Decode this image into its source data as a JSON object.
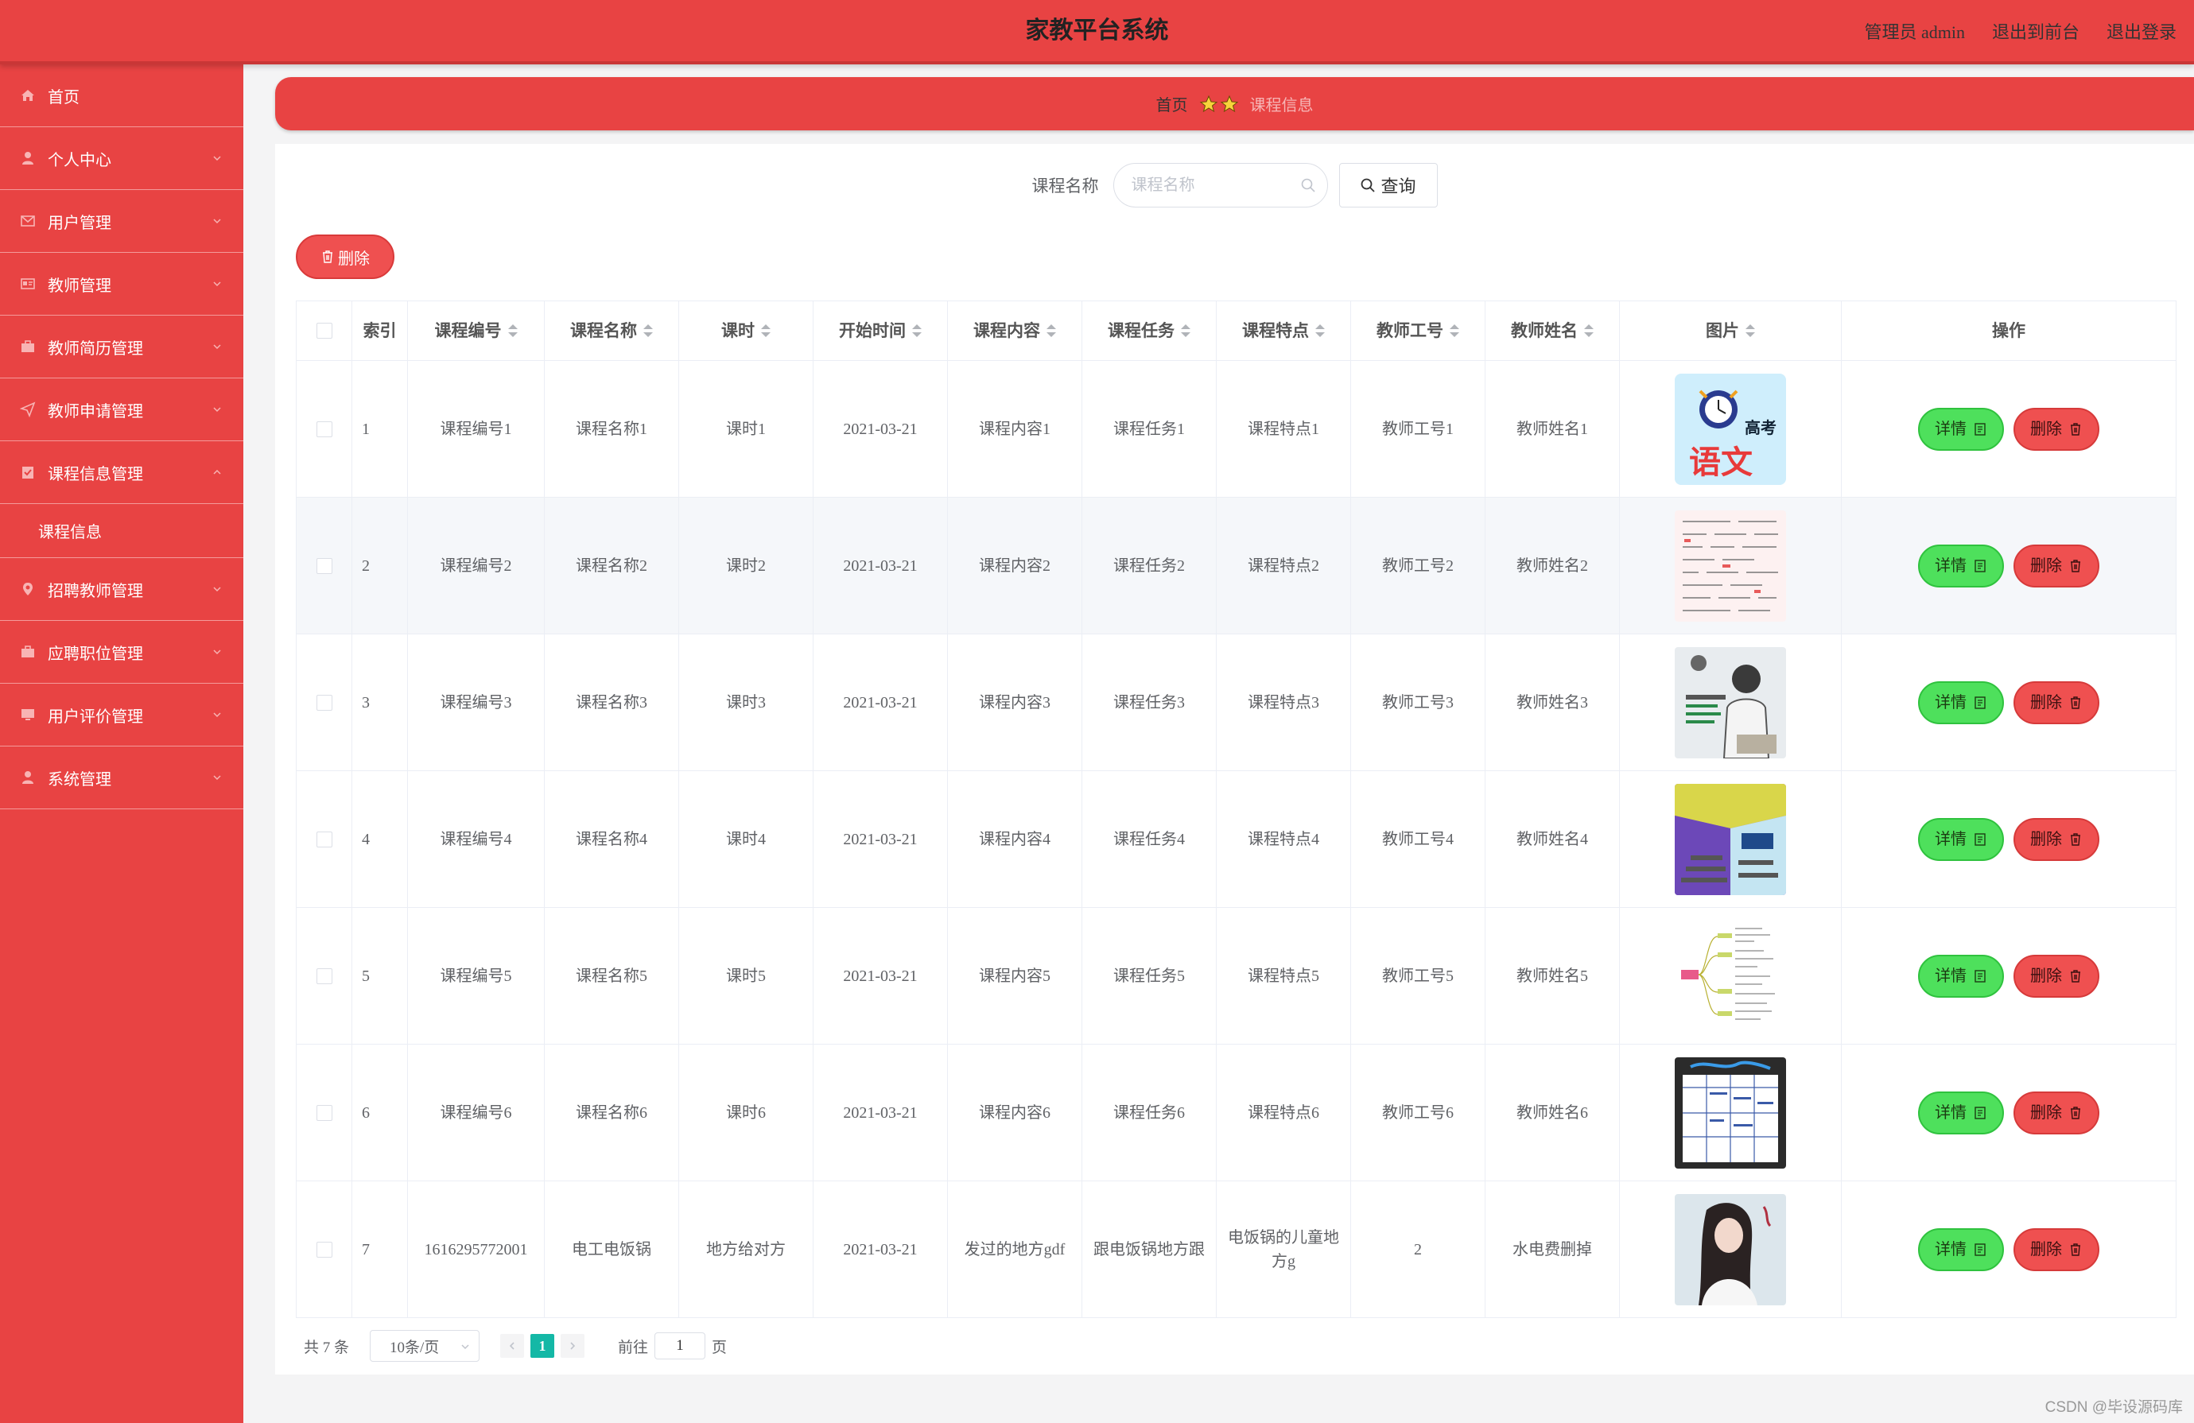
{
  "header": {
    "title": "家教平台系统",
    "admin_label": "管理员 admin",
    "front_link": "退出到前台",
    "logout_link": "退出登录"
  },
  "sidebar": {
    "items": [
      {
        "label": "首页",
        "icon": "home-icon"
      },
      {
        "label": "个人中心",
        "icon": "user-icon"
      },
      {
        "label": "用户管理",
        "icon": "mail-icon"
      },
      {
        "label": "教师管理",
        "icon": "id-card-icon"
      },
      {
        "label": "教师简历管理",
        "icon": "briefcase-icon"
      },
      {
        "label": "教师申请管理",
        "icon": "send-icon"
      },
      {
        "label": "课程信息管理",
        "icon": "clipboard-icon"
      },
      {
        "label": "招聘教师管理",
        "icon": "location-icon"
      },
      {
        "label": "应聘职位管理",
        "icon": "briefcase-icon"
      },
      {
        "label": "用户评价管理",
        "icon": "monitor-icon"
      },
      {
        "label": "系统管理",
        "icon": "user-icon"
      }
    ],
    "sub_item": "课程信息"
  },
  "breadcrumb": {
    "home": "首页",
    "current": "课程信息"
  },
  "search": {
    "label": "课程名称",
    "placeholder": "课程名称",
    "button": "查询"
  },
  "batch_delete": "删除",
  "table": {
    "columns": [
      "索引",
      "课程编号",
      "课程名称",
      "课时",
      "开始时间",
      "课程内容",
      "课程任务",
      "课程特点",
      "教师工号",
      "教师姓名",
      "图片",
      "操作"
    ],
    "rows": [
      {
        "idx": "1",
        "code": "课程编号1",
        "name": "课程名称1",
        "hours": "课时1",
        "start": "2021-03-21",
        "content": "课程内容1",
        "task": "课程任务1",
        "feature": "课程特点1",
        "tno": "教师工号1",
        "tname": "教师姓名1"
      },
      {
        "idx": "2",
        "code": "课程编号2",
        "name": "课程名称2",
        "hours": "课时2",
        "start": "2021-03-21",
        "content": "课程内容2",
        "task": "课程任务2",
        "feature": "课程特点2",
        "tno": "教师工号2",
        "tname": "教师姓名2"
      },
      {
        "idx": "3",
        "code": "课程编号3",
        "name": "课程名称3",
        "hours": "课时3",
        "start": "2021-03-21",
        "content": "课程内容3",
        "task": "课程任务3",
        "feature": "课程特点3",
        "tno": "教师工号3",
        "tname": "教师姓名3"
      },
      {
        "idx": "4",
        "code": "课程编号4",
        "name": "课程名称4",
        "hours": "课时4",
        "start": "2021-03-21",
        "content": "课程内容4",
        "task": "课程任务4",
        "feature": "课程特点4",
        "tno": "教师工号4",
        "tname": "教师姓名4"
      },
      {
        "idx": "5",
        "code": "课程编号5",
        "name": "课程名称5",
        "hours": "课时5",
        "start": "2021-03-21",
        "content": "课程内容5",
        "task": "课程任务5",
        "feature": "课程特点5",
        "tno": "教师工号5",
        "tname": "教师姓名5"
      },
      {
        "idx": "6",
        "code": "课程编号6",
        "name": "课程名称6",
        "hours": "课时6",
        "start": "2021-03-21",
        "content": "课程内容6",
        "task": "课程任务6",
        "feature": "课程特点6",
        "tno": "教师工号6",
        "tname": "教师姓名6"
      },
      {
        "idx": "7",
        "code": "1616295772001",
        "name": "电工电饭锅",
        "hours": "地方给对方",
        "start": "2021-03-21",
        "content": "发过的地方gdf",
        "task": "跟电饭锅地方跟",
        "feature": "电饭锅的儿童地方g",
        "tno": "2",
        "tname": "水电费删掉"
      }
    ],
    "detail_label": "详情",
    "delete_label": "删除",
    "thumb_text_1": "高考",
    "thumb_text_2": "语文"
  },
  "pager": {
    "total": "共 7 条",
    "page_size": "10条/页",
    "current": "1",
    "goto_prefix": "前往",
    "goto_value": "1",
    "goto_suffix": "页"
  },
  "watermark": "CSDN @毕设源码库",
  "colors": {
    "primary": "#e84343",
    "success": "#4ee05c",
    "pager_active": "#14b8a6"
  }
}
